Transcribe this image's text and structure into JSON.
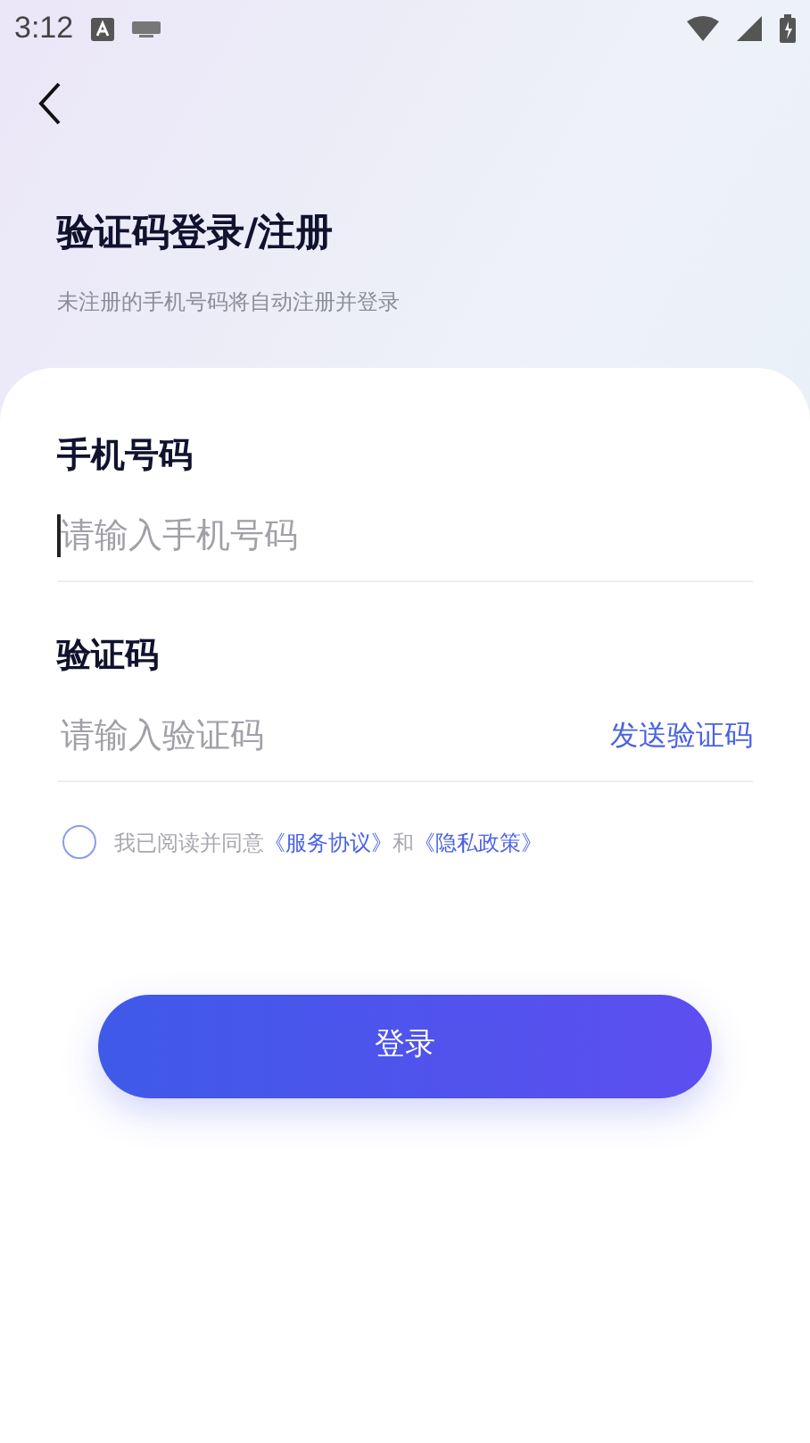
{
  "status_bar": {
    "time": "3:12"
  },
  "header": {
    "title": "验证码登录/注册",
    "subtitle": "未注册的手机号码将自动注册并登录"
  },
  "fields": [
    {
      "kind": "phone",
      "label": "手机号码",
      "placeholder": "请输入手机号码",
      "focused": true
    },
    {
      "kind": "code",
      "label": "验证码",
      "placeholder": "请输入验证码",
      "focused": false,
      "action": "发送验证码"
    }
  ],
  "agreement": {
    "checked": false,
    "parts": [
      {
        "kind": "text",
        "text": "我已阅读并同意"
      },
      {
        "kind": "link",
        "text": "《服务协议》"
      },
      {
        "kind": "text",
        "text": "和"
      },
      {
        "kind": "link",
        "text": "《隐私政策》"
      }
    ]
  },
  "login_button": "登录"
}
